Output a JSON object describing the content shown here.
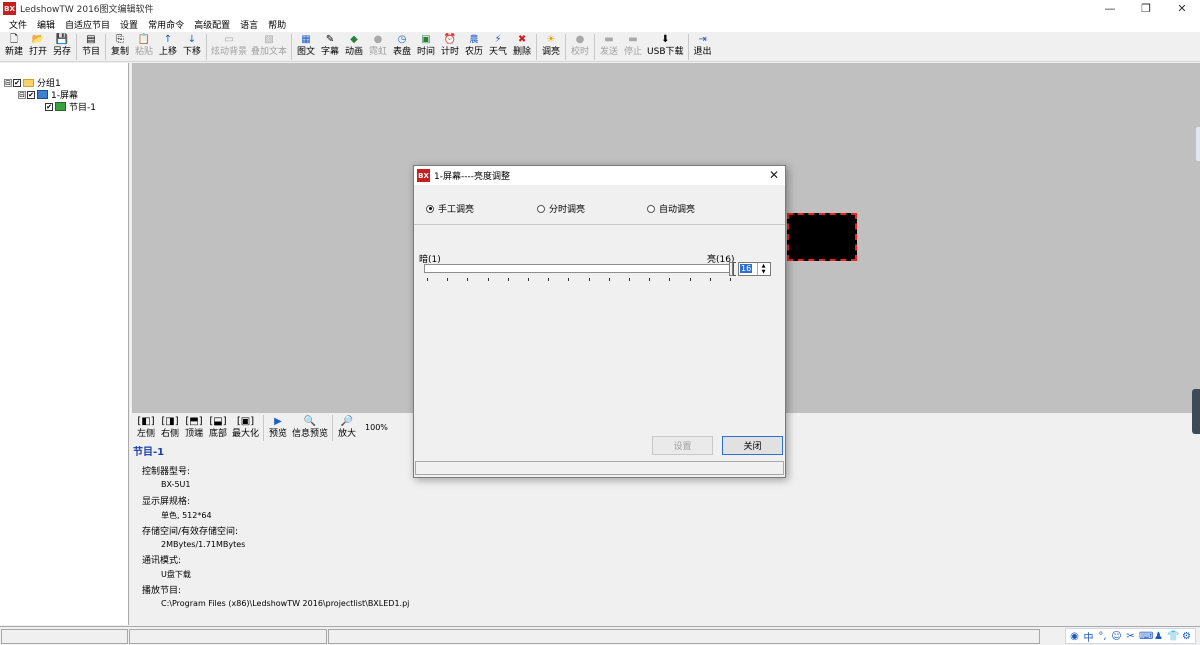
{
  "window": {
    "app_icon_text": "BX",
    "title": "LedshowTW 2016图文编辑软件",
    "minimize": "—",
    "maximize": "❐",
    "close": "✕"
  },
  "menu": [
    "文件",
    "编辑",
    "自适应节目",
    "设置",
    "常用命令",
    "高级配置",
    "语言",
    "帮助"
  ],
  "toolbar": {
    "file": [
      {
        "icon": "🗋",
        "label": "新建"
      },
      {
        "icon": "📂",
        "label": "打开"
      },
      {
        "icon": "💾",
        "label": "另存"
      }
    ],
    "program": {
      "icon": "▤",
      "label": "节目"
    },
    "edit": [
      {
        "icon": "⎘",
        "label": "复制"
      },
      {
        "icon": "📋",
        "label": "粘贴"
      },
      {
        "icon": "↑",
        "label": "上移"
      },
      {
        "icon": "↓",
        "label": "下移"
      }
    ],
    "bg": [
      {
        "icon": "▭",
        "label": "炫动背景"
      },
      {
        "icon": "▧",
        "label": "叠加文本"
      }
    ],
    "areas": [
      {
        "icon": "▦",
        "label": "图文"
      },
      {
        "icon": "✎",
        "label": "字幕"
      },
      {
        "icon": "◆",
        "label": "动画"
      },
      {
        "icon": "●",
        "label": "霓虹"
      },
      {
        "icon": "◷",
        "label": "表盘"
      },
      {
        "icon": "▣",
        "label": "时间"
      },
      {
        "icon": "⏰",
        "label": "计时"
      },
      {
        "icon": "農",
        "label": "农历"
      },
      {
        "icon": "⚡",
        "label": "天气"
      },
      {
        "icon": "✖",
        "label": "删除"
      }
    ],
    "brightness": {
      "icon": "☀",
      "label": "调亮"
    },
    "calibrate": {
      "icon": "●",
      "label": "校时"
    },
    "comm": [
      {
        "icon": "▬",
        "label": "发送"
      },
      {
        "icon": "▬",
        "label": "停止"
      },
      {
        "icon": "⬇",
        "label": "USB下载"
      }
    ],
    "exit": {
      "icon": "⇥",
      "label": "退出"
    }
  },
  "tree": {
    "group": "分组1",
    "screen": "1-屏幕",
    "program": "节目-1",
    "expand_sign": "⊟",
    "check_sign": "✔"
  },
  "bottom_toolbar": {
    "buttons": [
      {
        "icon": "[◧]",
        "label": "左侧"
      },
      {
        "icon": "[◨]",
        "label": "右侧"
      },
      {
        "icon": "[⬒]",
        "label": "顶端"
      },
      {
        "icon": "[⬓]",
        "label": "底部"
      },
      {
        "icon": "[▣]",
        "label": "最大化"
      },
      {
        "icon": "▶",
        "label": "预览"
      },
      {
        "icon": "🔍",
        "label": "信息预览"
      },
      {
        "icon": "🔎",
        "label": "放大"
      }
    ],
    "zoom": "100%"
  },
  "info": {
    "title": "节目-1",
    "controller_label": "控制器型号:",
    "controller_value": "BX-5U1",
    "display_label": "显示屏规格:",
    "display_value": "单色, 512*64",
    "storage_label": "存储空间/有效存储空间:",
    "storage_value": "2MBytes/1.71MBytes",
    "comm_label": "通讯模式:",
    "comm_value": "U盘下载",
    "playlist_label": "播放节目:",
    "playlist_value": "C:\\Program Files (x86)\\LedshowTW 2016\\projectlist\\BXLED1.pj"
  },
  "dialog": {
    "title": "1-屏幕----亮度调整",
    "close": "✕",
    "modes": [
      "手工调亮",
      "分时调亮",
      "自动调亮"
    ],
    "selected_mode": "手工调亮",
    "dark_label": "暗(1)",
    "bright_label": "亮(16)",
    "brightness_value": "16",
    "level_fraction": 1.0,
    "set_button": "设置",
    "close_button": "关闭",
    "spin_up": "▲",
    "spin_down": "▼"
  },
  "ime": [
    "◉",
    "中",
    "°,",
    "☺",
    "✂",
    "⌨",
    "♟",
    "👕",
    "⚙"
  ]
}
